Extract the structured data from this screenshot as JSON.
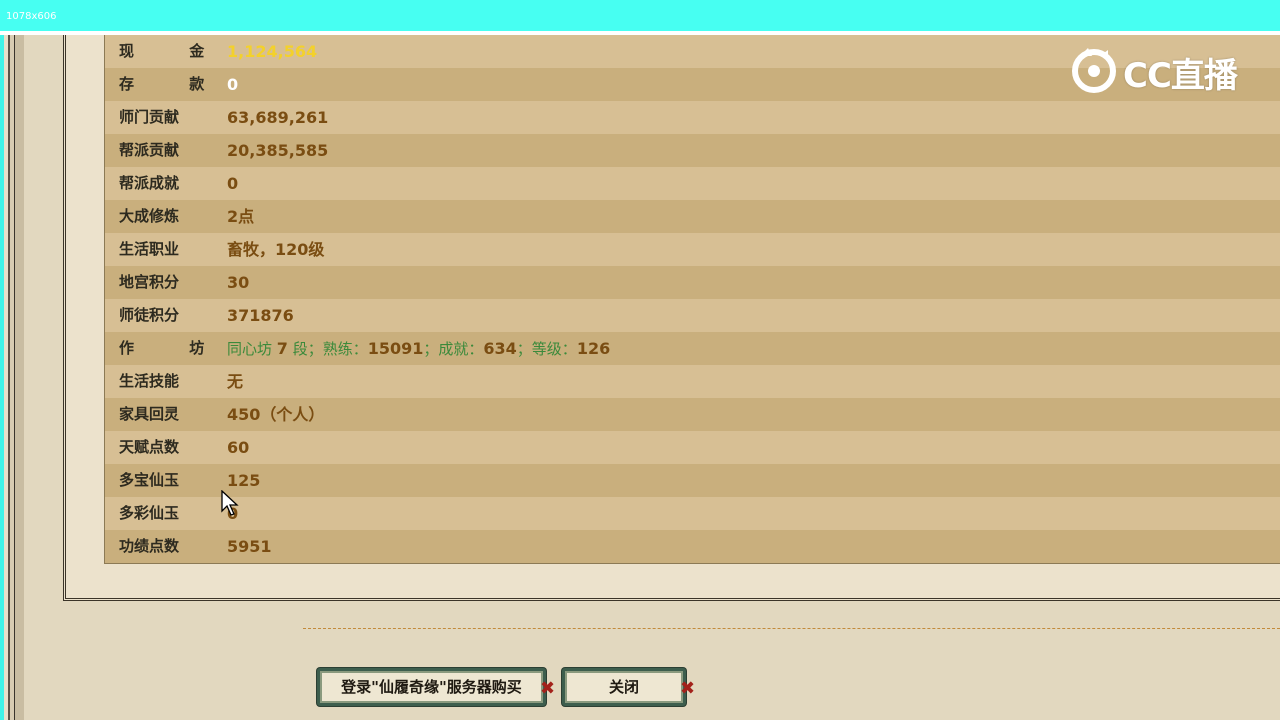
{
  "capture": {
    "dimension_label": "1078x606"
  },
  "logo": {
    "text": "CC直播"
  },
  "stats": [
    {
      "label": "现 金",
      "value": "1,124,564",
      "style": "gold",
      "wide": true
    },
    {
      "label": "存 款",
      "value": "0",
      "style": "white",
      "wide": true
    },
    {
      "label": "师门贡献",
      "value": "63,689,261"
    },
    {
      "label": "帮派贡献",
      "value": "20,385,585"
    },
    {
      "label": "帮派成就",
      "value": "0"
    },
    {
      "label": "大成修炼",
      "value": "2点"
    },
    {
      "label": "生活职业",
      "value": "畜牧，120级"
    },
    {
      "label": "地宫积分",
      "value": "30"
    },
    {
      "label": "师徒积分",
      "value": "371876"
    },
    {
      "label": "作 坊",
      "wide": true,
      "parts": [
        {
          "text": "同心坊 ",
          "green": true
        },
        {
          "text": "7"
        },
        {
          "text": " 段；熟练：",
          "green": true
        },
        {
          "text": "15091"
        },
        {
          "text": "；成就：",
          "green": true
        },
        {
          "text": "634"
        },
        {
          "text": "；等级：",
          "green": true
        },
        {
          "text": "126"
        }
      ]
    },
    {
      "label": "生活技能",
      "value": "无"
    },
    {
      "label": "家具回灵",
      "value": "450（个人）"
    },
    {
      "label": "天赋点数",
      "value": "60"
    },
    {
      "label": "多宝仙玉",
      "value": "125"
    },
    {
      "label": "多彩仙玉",
      "value": "0"
    },
    {
      "label": "功绩点数",
      "value": "5951"
    }
  ],
  "buttons": {
    "buy_label": "登录\"仙履奇缘\"服务器购买",
    "close_label": "关闭"
  },
  "colors": {
    "row_light": "#d7bf94",
    "row_dark": "#c9af7d",
    "value": "#7a4d12",
    "gold": "#f3d12b"
  }
}
